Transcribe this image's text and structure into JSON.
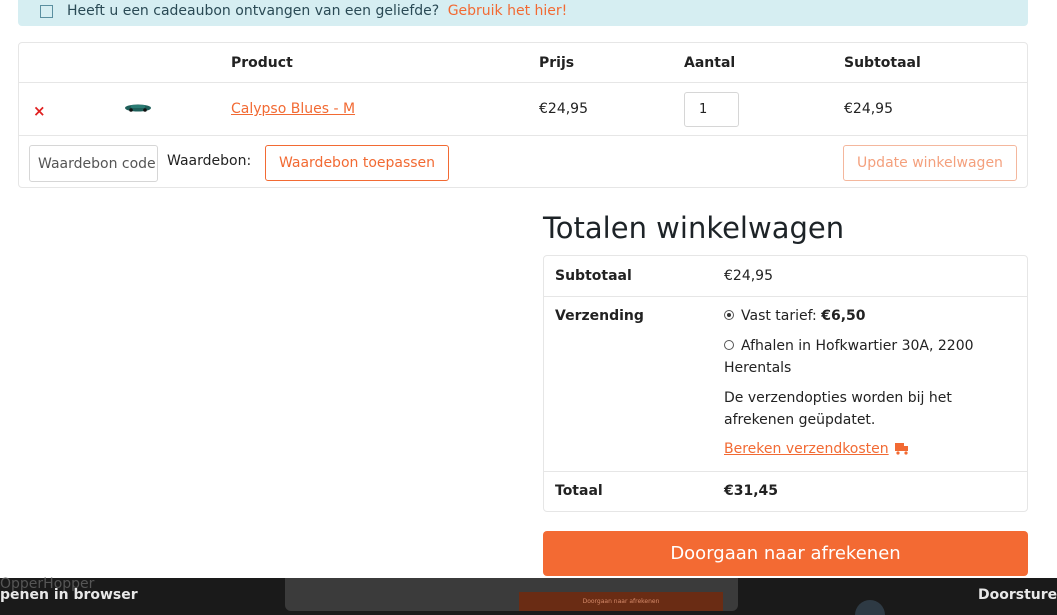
{
  "notice": {
    "text": "Heeft u een cadeaubon ontvangen van een geliefde?",
    "link": "Gebruik het hier!"
  },
  "cart": {
    "headers": {
      "product": "Product",
      "price": "Prijs",
      "quantity": "Aantal",
      "subtotal": "Subtotaal"
    },
    "items": [
      {
        "remove": "×",
        "name": "Calypso Blues - M",
        "price": "€24,95",
        "quantity": "1",
        "subtotal": "€24,95"
      }
    ],
    "coupon": {
      "placeholder": "Waardebon code",
      "label": "Waardebon:",
      "apply_label": "Waardebon toepassen"
    },
    "update_label": "Update winkelwagen"
  },
  "totals": {
    "title": "Totalen winkelwagen",
    "subtotal_label": "Subtotaal",
    "subtotal_value": "€24,95",
    "shipping_label": "Verzending",
    "shipping_option1_prefix": "Vast tarief: ",
    "shipping_option1_price": "€6,50",
    "shipping_option2": "Afhalen in Hofkwartier 30A, 2200 Herentals",
    "shipping_note": "De verzendopties worden bij het afrekenen geüpdatet.",
    "calc_link": "Bereken verzendkosten",
    "total_label": "Totaal",
    "total_value": "€31,45"
  },
  "checkout_label": "Doorgaan naar afrekenen",
  "bottombar": {
    "ghost_title": "OpperHopper",
    "open_label": "penen in browser",
    "preview_button": "Doorgaan naar afrekenen",
    "forward_label": "Doorsturen"
  },
  "colors": {
    "accent": "#f26a33",
    "notice_bg": "#d6eef2",
    "remove": "#e02020"
  }
}
